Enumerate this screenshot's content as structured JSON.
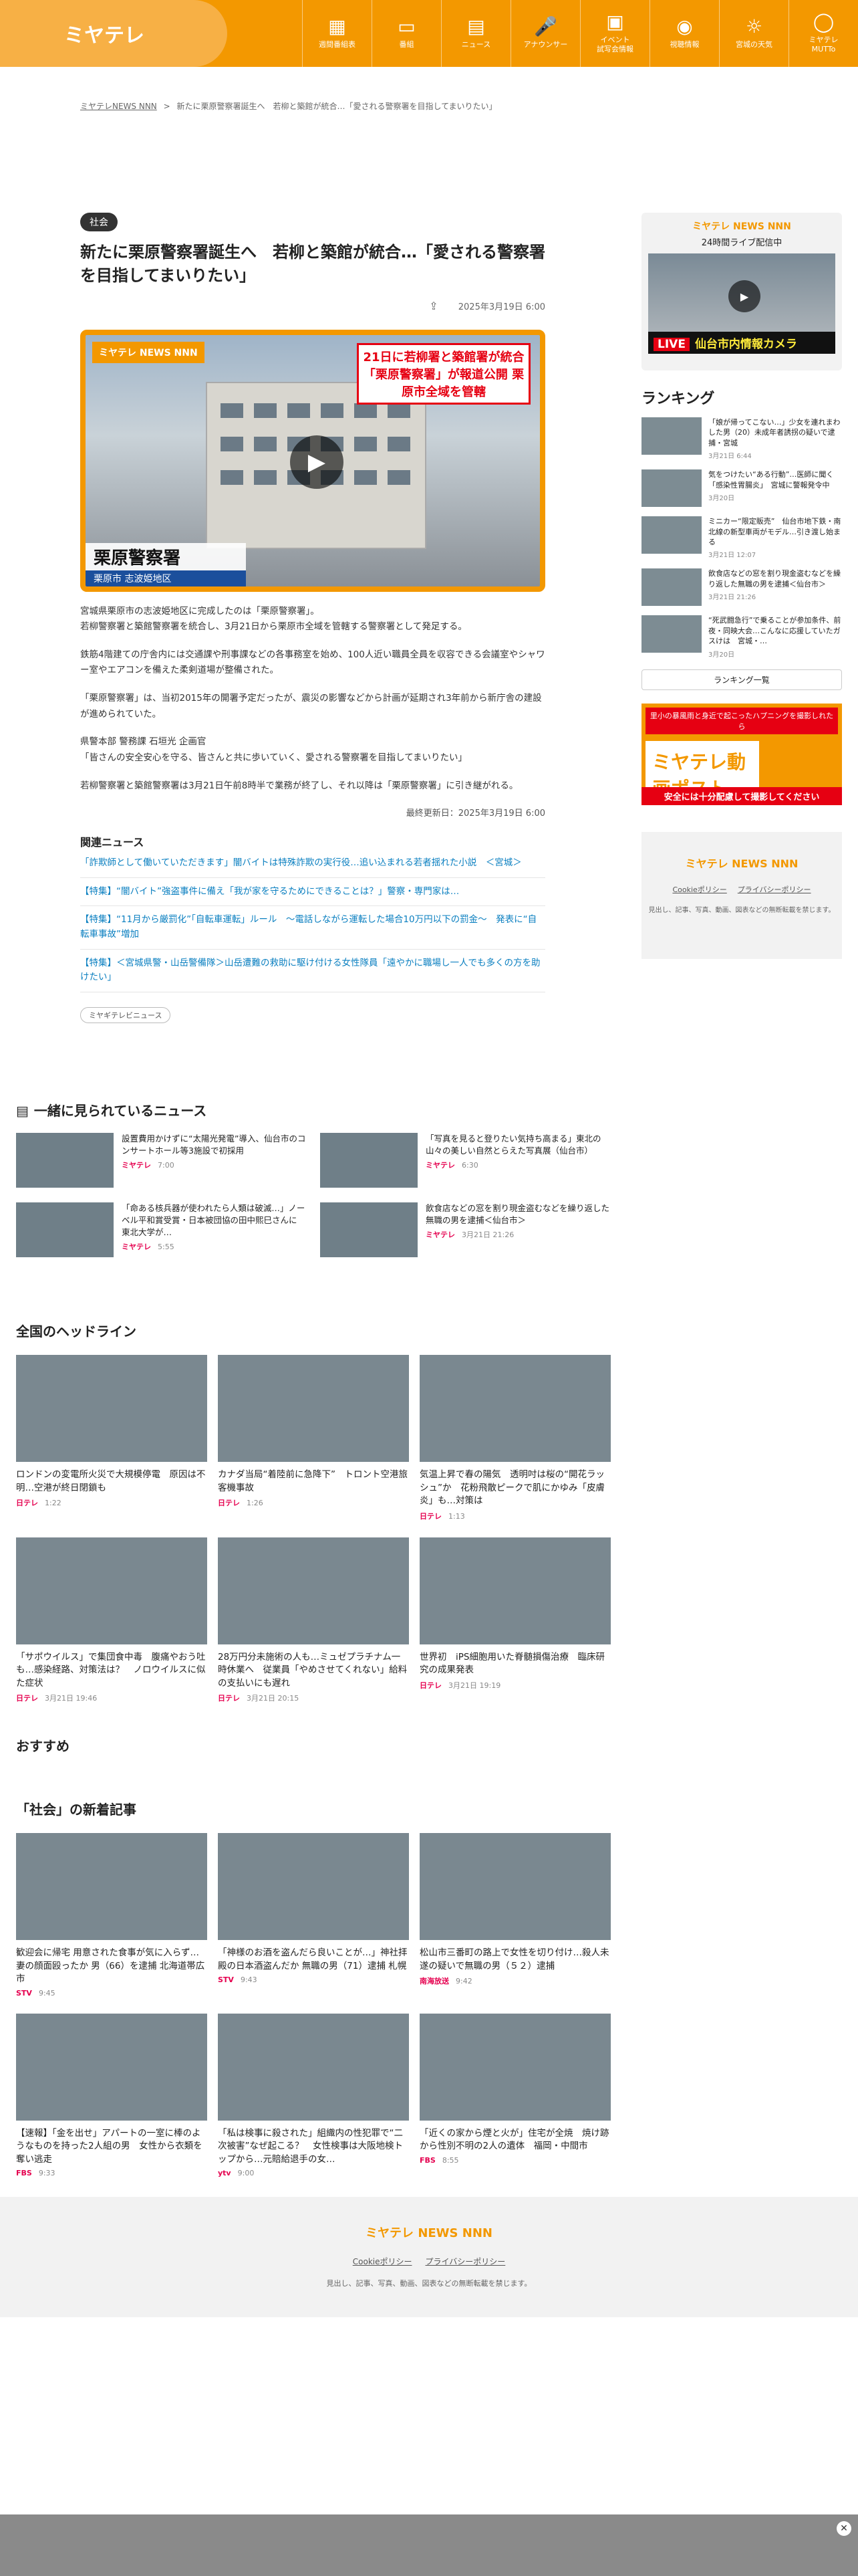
{
  "header": {
    "logo": "ミヤテレ",
    "nav": [
      {
        "icon": "▦",
        "label": "週間番組表"
      },
      {
        "icon": "▭",
        "label": "番組"
      },
      {
        "icon": "▤",
        "label": "ニュース"
      },
      {
        "icon": "🎤",
        "label": "アナウンサー"
      },
      {
        "icon": "▣",
        "label": "イベント\n試写会情報"
      },
      {
        "icon": "◉",
        "label": "視聴情報"
      },
      {
        "icon": "☼",
        "label": "宮城の天気"
      },
      {
        "icon": "◯",
        "label": "ミヤテレ\nMUTTo"
      }
    ]
  },
  "breadcrumb": {
    "home": "ミヤテレNEWS NNN",
    "sep": ">",
    "current": "新たに栗原警察署誕生へ　若柳と築館が統合…「愛される警察署を目指してまいりたい」"
  },
  "article": {
    "category": "社会",
    "title": "新たに栗原警察署誕生へ　若柳と築館が統合…「愛される警察署を目指してまいりたい」",
    "date": "2025年3月19日 6:00",
    "hero": {
      "logo": "ミヤテレ NEWS NNN",
      "telop": "21日に若柳署と築館署が統合「栗原警察署」が報道公開 栗原市全域を管轄",
      "place": "栗原警察署",
      "sub": "栗原市 志波姫地区"
    },
    "paras": [
      "宮城県栗原市の志波姫地区に完成したのは「栗原警察署」。\n若柳警察署と築館警察署を統合し、3月21日から栗原市全域を管轄する警察署として発足する。",
      "鉄筋4階建ての庁舎内には交通課や刑事課などの各事務室を始め、100人近い職員全員を収容できる会議室やシャワー室やエアコンを備えた柔剣道場が整備された。",
      "「栗原警察署」は、当初2015年の開署予定だったが、震災の影響などから計画が延期され3年前から新庁舎の建設が進められていた。",
      "県警本部 警務課 石垣光 企画官\n「皆さんの安全安心を守る、皆さんと共に歩いていく、愛される警察署を目指してまいりたい」",
      "若柳警察署と築館警察署は3月21日午前8時半で業務が終了し、それ以降は「栗原警察署」に引き継がれる。"
    ],
    "updated": "最終更新日：2025年3月19日 6:00",
    "related_title": "関連ニュース",
    "related": [
      "「詐欺師として働いていただきます」闇バイトは特殊詐欺の実行役…追い込まれる若者揺れた小説　＜宮城＞",
      "【特集】“闇バイト”強盗事件に備え「我が家を守るためにできることは？」警察・専門家は…",
      "【特集】“11月から厳罰化”「自転車運転」ルール　～電話しながら運転した場合10万円以下の罰金～　発表に“自転車事故”増加",
      "【特集】＜宮城県警・山岳警備隊＞山岳遭難の救助に駆け付ける女性隊員「遠やかに職場し一人でも多くの方を助けたい」"
    ],
    "source_badge": "ミヤギテレビニュース"
  },
  "sidebar": {
    "live": {
      "title": "ミヤテレ NEWS NNN",
      "sub": "24時間ライブ配信中",
      "bar_live": "LIVE",
      "bar_text": "仙台市内情報カメラ"
    },
    "ranking_title": "ランキング",
    "ranking": [
      {
        "t": "「娘が帰ってこない…」少女を連れまわした男（20）未成年者誘拐の疑いで逮捕・宮城",
        "d": "3月21日 6:44"
      },
      {
        "t": "気をつけたい“ある行動”…医師に聞く「感染性胃腸炎」　宮城に警報発令中",
        "d": "3月20日"
      },
      {
        "t": "ミニカー“限定販売”　仙台市地下鉄・南北線の新型車両がモデル…引き渡し始まる",
        "d": "3月21日 12:07"
      },
      {
        "t": "飲食店などの窓を割り現金盗むなどを繰り返した無職の男を逮捕＜仙台市＞",
        "d": "3月21日 21:26"
      },
      {
        "t": "“死武闘急行”で乗ることが参加条件、前夜・同映大会…こんなに応援していたガスけは　宮城・…",
        "d": "3月20日"
      }
    ],
    "ranking_all": "ランキング一覧",
    "post": {
      "top": "里小の暴風雨と身近で起こったハプニングを撮影しれたら",
      "main": "ミヤテレ動画ポスト",
      "bottom": "安全には十分配慮して撮影してください"
    },
    "footer": {
      "logo": "ミヤテレ NEWS NNN",
      "links": [
        "Cookieポリシー",
        "プライバシーポリシー"
      ],
      "copy": "見出し、記事、写真、動画、図表などの無断転載を禁じます。"
    }
  },
  "together": {
    "title": "一緒に見られているニュース",
    "items": [
      {
        "t": "設置費用かけずに“太陽光発電”導入、仙台市のコンサートホール等3施設で初採用",
        "s": "ミヤテレ",
        "d": "7:00"
      },
      {
        "t": "「写真を見ると登りたい気持ち高まる」東北の山々の美しい自然とらえた写真展（仙台市）",
        "s": "ミヤテレ",
        "d": "6:30"
      },
      {
        "t": "「命ある核兵器が使われたら人類は破滅…」ノーベル平和賞受賞・日本被団協の田中熙巳さんに　東北大学が…",
        "s": "ミヤテレ",
        "d": "5:55"
      },
      {
        "t": "飲食店などの窓を割り現金盗むなどを繰り返した無職の男を逮捕＜仙台市＞",
        "s": "ミヤテレ",
        "d": "3月21日 21:26"
      }
    ]
  },
  "headlines": {
    "title": "全国のヘッドライン",
    "items": [
      {
        "t": "ロンドンの変電所火災で大規模停電　原因は不明…空港が終日閉鎖も",
        "s": "日テレ",
        "d": "1:22"
      },
      {
        "t": "カナダ当局“着陸前に急降下”　トロント空港旅客機事故",
        "s": "日テレ",
        "d": "1:26"
      },
      {
        "t": "気温上昇で春の陽気　透明吋は桜の“開花ラッシュ”か　花粉飛散ピークで肌にかゆみ「皮膚炎」も…対策は",
        "s": "日テレ",
        "d": "1:13"
      },
      {
        "t": "「サポウイルス」で集団食中毒　腹痛やおう吐も…感染経路、対策法は？　ノロウイルスに似た症状",
        "s": "日テレ",
        "d": "3月21日 19:46"
      },
      {
        "t": "28万円分未施術の人も…ミュゼプラチナム一時休業へ　従業員「やめさせてくれない」給料の支払いにも遅れ",
        "s": "日テレ",
        "d": "3月21日 20:15"
      },
      {
        "t": "世界初　iPS細胞用いた脊髄損傷治療　臨床研究の成果発表",
        "s": "日テレ",
        "d": "3月21日 19:19"
      }
    ]
  },
  "recommend_title": "おすすめ",
  "social": {
    "title": "「社会」の新着記事",
    "items": [
      {
        "t": "歓迎会に帰宅 用意された食事が気に入らず…妻の顔面殴ったか 男（66）を逮捕 北海道帯広市",
        "s": "STV",
        "d": "9:45"
      },
      {
        "t": "「神様のお酒を盗んだら良いことが…」神社拝殿の日本酒盗んだか 無職の男（71）逮捕 札幌",
        "s": "STV",
        "d": "9:43"
      },
      {
        "t": "松山市三番町の路上で女性を切り付け…殺人未遂の疑いで無職の男（５２）逮捕",
        "s": "南海放送",
        "d": "9:42"
      },
      {
        "t": "【速報】「金を出せ」アパートの一室に棒のようなものを持った2人組の男　女性から衣類を奪い逃走",
        "s": "FBS",
        "d": "9:33"
      },
      {
        "t": "「私は検事に殺された」組織内の性犯罪で“二次被害”なぜ起こる？　女性検事は大阪地検トップから…元賠給退手の女…",
        "s": "ytv",
        "d": "9:00"
      },
      {
        "t": "「近くの家から煙と火が」住宅が全焼　焼け跡から性別不明の2人の遺体　福岡・中間市",
        "s": "FBS",
        "d": "8:55"
      }
    ]
  },
  "footer": {
    "logo": "ミヤテレ NEWS NNN",
    "links": [
      "Cookieポリシー",
      "プライバシーポリシー"
    ],
    "copy": "見出し、記事、写真、動画、図表などの無断転載を禁じます。"
  },
  "colors": {
    "brand": "#f39800",
    "link": "#0a7fc0",
    "accent": "#e60012"
  }
}
